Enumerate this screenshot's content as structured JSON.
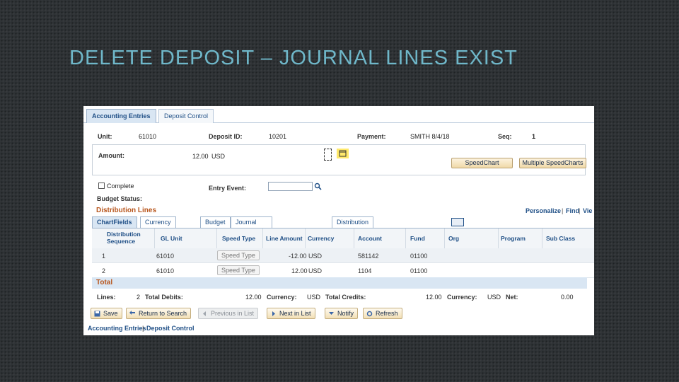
{
  "slide_title": "DELETE DEPOSIT – JOURNAL LINES EXIST",
  "top_tabs": [
    "Accounting Entries",
    "Deposit Control"
  ],
  "header": {
    "unit_label": "Unit:",
    "unit_value": "61010",
    "deposit_id_label": "Deposit ID:",
    "deposit_id_value": "10201",
    "payment_label": "Payment:",
    "payment_value": "SMITH 8/4/18",
    "seq_label": "Seq:",
    "seq_value": "1"
  },
  "amount": {
    "label": "Amount:",
    "value": "12.00",
    "currency": "USD"
  },
  "buttons": {
    "speedchart": "SpeedChart",
    "multiple_speedcharts": "Multiple SpeedCharts"
  },
  "complete_label": "Complete",
  "entry_event_label": "Entry Event:",
  "budget_status_label": "Budget Status:",
  "distribution": {
    "title": "Distribution Lines",
    "personalize": "Personalize",
    "find": "Find",
    "view": "Vie",
    "tabs": [
      "ChartFields",
      "Currency Details",
      "Budget",
      "Journal Reference Information",
      "Distribution Creation / Update Details"
    ],
    "columns": {
      "seq": "Distribution Sequence",
      "gl_unit": "GL Unit",
      "speed_type": "Speed Type",
      "line_amount": "Line Amount",
      "currency": "Currency",
      "account": "Account",
      "fund": "Fund",
      "org": "Org",
      "program": "Program",
      "sub_class": "Sub Class"
    },
    "rows": [
      {
        "seq": "1",
        "gl_unit": "61010",
        "speed_type": "Speed Type",
        "line_amount": "-12.00",
        "currency": "USD",
        "account": "581142",
        "fund": "01100"
      },
      {
        "seq": "2",
        "gl_unit": "61010",
        "speed_type": "Speed Type",
        "line_amount": "12.00",
        "currency": "USD",
        "account": "1104",
        "fund": "01100"
      }
    ]
  },
  "total": {
    "title": "Total",
    "lines_label": "Lines:",
    "lines_value": "2",
    "debits_label": "Total Debits:",
    "debits_value": "12.00",
    "currency_label": "Currency:",
    "currency_value": "USD",
    "credits_label": "Total Credits:",
    "credits_value": "12.00",
    "currency2_label": "Currency:",
    "currency2_value": "USD",
    "net_label": "Net:",
    "net_value": "0.00"
  },
  "toolbar": {
    "save": "Save",
    "return_to_search": "Return to Search",
    "previous_in_list": "Previous in List",
    "next_in_list": "Next in List",
    "notify": "Notify",
    "refresh": "Refresh"
  },
  "bottom_links": {
    "accounting_entries": "Accounting Entries",
    "separator": "|",
    "deposit_control": "Deposit Control"
  },
  "colors": {
    "title": "#6fb7c9",
    "grid_title": "#b8561d",
    "link": "#1f4f86"
  }
}
